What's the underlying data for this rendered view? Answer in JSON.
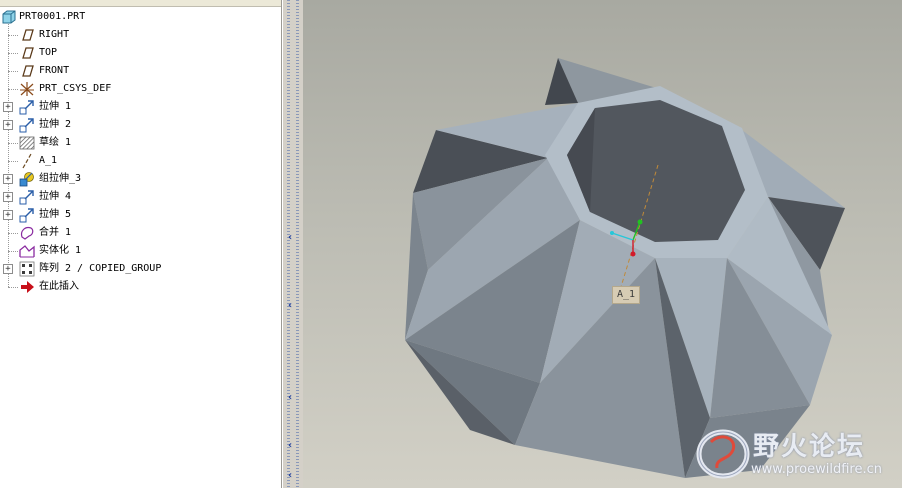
{
  "model_tree": {
    "items": [
      {
        "label": "PRT0001.PRT",
        "icon": "part-icon",
        "expandable": false
      },
      {
        "label": "RIGHT",
        "icon": "datum-plane-icon",
        "expandable": false
      },
      {
        "label": "TOP",
        "icon": "datum-plane-icon",
        "expandable": false
      },
      {
        "label": "FRONT",
        "icon": "datum-plane-icon",
        "expandable": false
      },
      {
        "label": "PRT_CSYS_DEF",
        "icon": "csys-icon",
        "expandable": false
      },
      {
        "label": "拉伸 1",
        "icon": "extrude-icon",
        "expandable": true
      },
      {
        "label": "拉伸 2",
        "icon": "extrude-icon",
        "expandable": true
      },
      {
        "label": "草绘 1",
        "icon": "sketch-icon",
        "expandable": false
      },
      {
        "label": "A_1",
        "icon": "datum-axis-icon",
        "expandable": false
      },
      {
        "label": "组拉伸_3",
        "icon": "group-extrude-icon",
        "expandable": true
      },
      {
        "label": "拉伸 4",
        "icon": "extrude-icon",
        "expandable": true
      },
      {
        "label": "拉伸 5",
        "icon": "extrude-icon",
        "expandable": true
      },
      {
        "label": "合并 1",
        "icon": "merge-icon",
        "expandable": false
      },
      {
        "label": "实体化 1",
        "icon": "solidify-icon",
        "expandable": false
      },
      {
        "label": "阵列 2 / COPIED_GROUP",
        "icon": "pattern-icon",
        "expandable": true
      },
      {
        "label": "在此插入",
        "icon": "insert-here-arrow-icon",
        "expandable": false
      }
    ]
  },
  "viewport": {
    "datum_axis_label": "A_1"
  },
  "watermark": {
    "title": "野火论坛",
    "url": "www.proewildfire.cn"
  },
  "colors": {
    "viewport_bg_top": "#a8a9a1",
    "viewport_bg_bottom": "#d2d0c6",
    "model_light": "#a9b4bf",
    "model_mid": "#8b949d",
    "model_dark": "#4f545b",
    "insert_arrow": "#c8101a"
  }
}
